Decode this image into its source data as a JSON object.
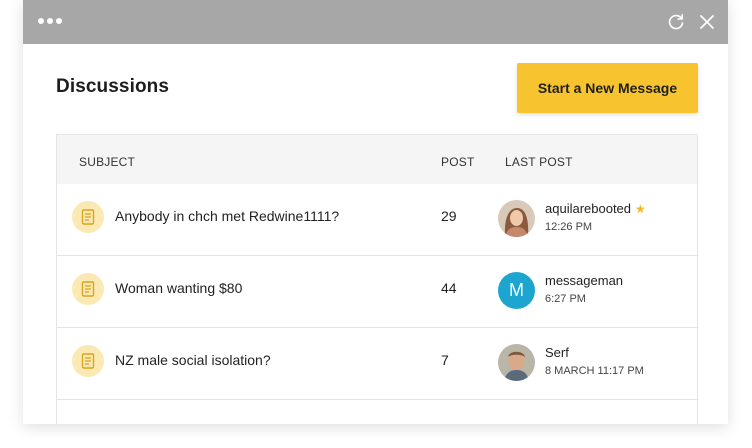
{
  "window": {
    "title_icons": [
      "menu-dots-icon",
      "refresh-icon",
      "close-icon"
    ]
  },
  "page": {
    "title": "Discussions",
    "new_message_button": "Start a New Message"
  },
  "table": {
    "columns": {
      "subject": "SUBJECT",
      "post": "POST",
      "last_post": "LAST POST"
    },
    "rows": [
      {
        "subject": "Anybody in chch met Redwine1111?",
        "posts": "29",
        "user": "aquilarebooted",
        "starred": true,
        "time": "12:26 PM",
        "avatar": "photo"
      },
      {
        "subject": "Woman wanting $80",
        "posts": "44",
        "user": "messageman",
        "starred": false,
        "time": "6:27 PM",
        "avatar": "letter",
        "avatar_letter": "M"
      },
      {
        "subject": "NZ male social isolation?",
        "posts": "7",
        "user": "Serf",
        "starred": false,
        "time": "8 MARCH 11:17 PM",
        "avatar": "photo"
      }
    ]
  },
  "colors": {
    "accent": "#f7c430",
    "titlebar": "#a7a7a7",
    "avatar_letter_bg": "#1ca5cf"
  }
}
